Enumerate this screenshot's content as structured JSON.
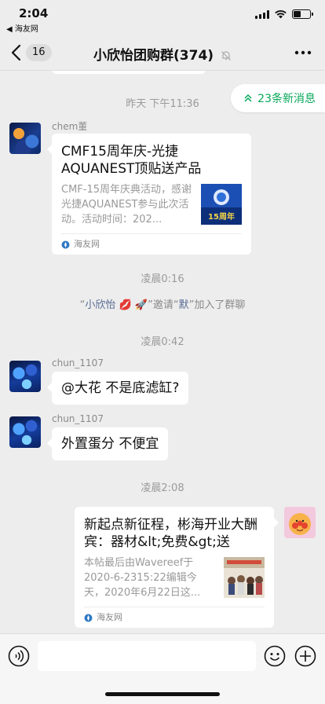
{
  "status_bar": {
    "time": "2:04",
    "back_app": "◀ 海友网"
  },
  "nav": {
    "back_count": "16",
    "title": "小欣怡团购群(374)"
  },
  "new_messages": {
    "label": "23条新消息"
  },
  "timestamps": {
    "t1": "昨天 下午11:36",
    "t2": "凌晨0:16",
    "t3": "凌晨0:42",
    "t4": "凌晨2:08"
  },
  "messages": {
    "m1": {
      "sender": "chem董",
      "card": {
        "title": "CMF15周年庆-光捷AQUANEST顶贴送产品",
        "desc": "CMF-15周年庆典活动，感谢光捷AQUANEST参与此次活动。活动时间：202...",
        "source": "海友网",
        "thumb_text": "15周年"
      }
    },
    "system": {
      "q1": "“",
      "inviter": "小欣怡",
      "emoji": " 💋 🚀",
      "mid": "”邀请“",
      "invitee": "默",
      "end": "”加入了群聊"
    },
    "m2": {
      "sender": "chun_1107",
      "text": "@大花 不是底滤缸?"
    },
    "m3": {
      "sender": "chun_1107",
      "text": "外置蛋分 不便宜"
    },
    "m4": {
      "card": {
        "title": "新起点新征程，彬海开业大酬宾：器材&lt;免费&gt;送",
        "desc": "本帖最后由Wavereef于2020-6-2315:22编辑今天，2020年6月22日这...",
        "source": "海友网"
      }
    }
  },
  "colors": {
    "accent_green": "#07a85a",
    "link_blue": "#576b95",
    "background": "#ededed"
  }
}
